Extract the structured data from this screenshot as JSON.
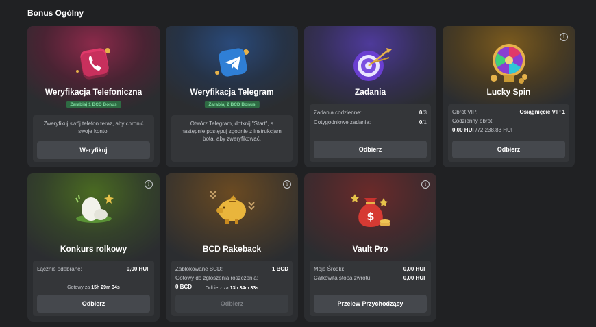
{
  "section_title": "Bonus Ogólny",
  "cards": {
    "phone": {
      "title": "Weryfikacja Telefoniczna",
      "badge": "Zarabiaj 1 BCD Bonus",
      "desc": "Zweryfikuj swój telefon teraz, aby chronić swoje konto.",
      "button": "Weryfikuj",
      "icon": "phone-icon"
    },
    "telegram": {
      "title": "Weryfikacja Telegram",
      "badge": "Zarabiaj 2 BCD Bonus",
      "desc": "Otwórz Telegram, dotknij \"Start\", a następnie postępuj zgodnie z instrukcjami bota, aby zweryfikować.",
      "icon": "telegram-icon"
    },
    "tasks": {
      "title": "Zadania",
      "daily_label": "Zadania codzienne:",
      "daily_done": "0",
      "daily_total": "/3",
      "weekly_label": "Cotygodniowe zadania:",
      "weekly_done": "0",
      "weekly_total": "/1",
      "button": "Odbierz",
      "icon": "target-icon"
    },
    "lucky": {
      "title": "Lucky Spin",
      "vip_label": "Obrót VIP:",
      "vip_value": "Osiągnięcie VIP 1",
      "daily_label": "Codzienny obrót:",
      "daily_value": "0,00 HUF",
      "daily_total": "/72 238,83 HUF",
      "button": "Odbierz",
      "icon": "wheel-icon"
    },
    "roll": {
      "title": "Konkurs rolkowy",
      "received_label": "Łącznie odebrane:",
      "received_value": "0,00 HUF",
      "ready_label": "Gotowy za",
      "ready_time": "15h 29m 34s",
      "button": "Odbierz",
      "icon": "egg-icon"
    },
    "rakeback": {
      "title": "BCD Rakeback",
      "locked_label": "Zablokowane BCD:",
      "locked_value": "1 BCD",
      "claim_label": "Gotowy do zgłoszenia roszczenia:",
      "claim_value": "0 BCD",
      "ready_label": "Odbierz za",
      "ready_time": "13h 34m 33s",
      "button": "Odbierz",
      "icon": "piggy-bank-icon"
    },
    "vault": {
      "title": "Vault Pro",
      "funds_label": "Moje Środki:",
      "funds_value": "0,00 HUF",
      "rate_label": "Całkowita stopa zwrotu:",
      "rate_value": "0,00 HUF",
      "button": "Przelew Przychodzący",
      "icon": "money-bag-icon"
    }
  },
  "colors": {
    "page_bg": "#202123",
    "card_bg": "#2b2d30",
    "badge_bg": "#2e6b43",
    "badge_text": "#7fdba0",
    "button_bg": "#45484d"
  }
}
